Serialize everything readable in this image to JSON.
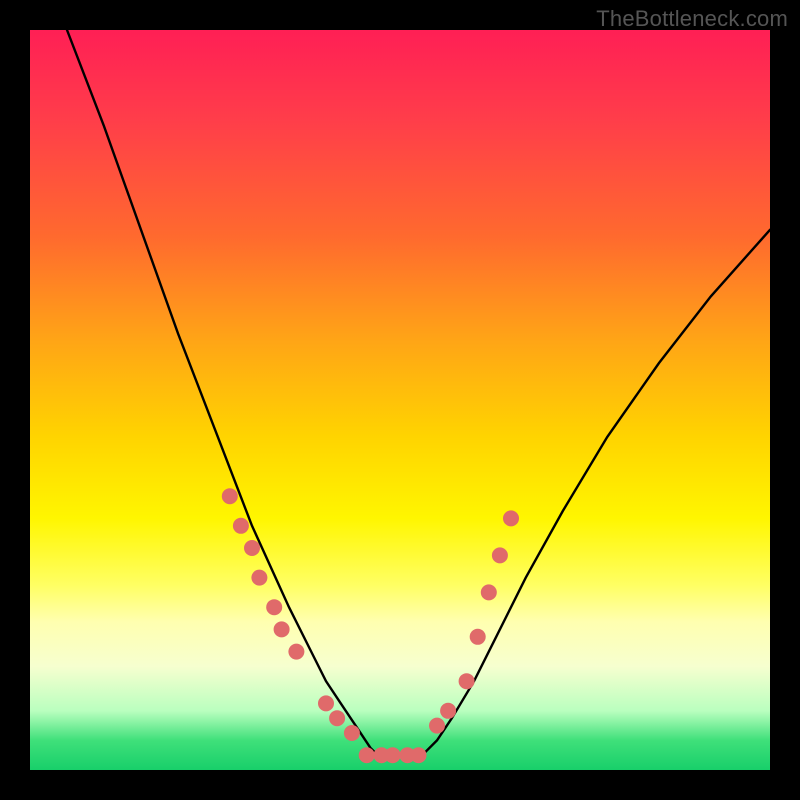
{
  "watermark": "TheBottleneck.com",
  "chart_data": {
    "type": "line",
    "title": "",
    "xlabel": "",
    "ylabel": "",
    "xlim": [
      0,
      100
    ],
    "ylim": [
      0,
      100
    ],
    "series": [
      {
        "name": "left-curve",
        "x": [
          5,
          10,
          15,
          20,
          25,
          30,
          35,
          38,
          40,
          42,
          44,
          46,
          47
        ],
        "y": [
          100,
          87,
          73,
          59,
          46,
          33,
          22,
          16,
          12,
          9,
          6,
          3,
          2
        ]
      },
      {
        "name": "right-curve",
        "x": [
          53,
          55,
          57,
          60,
          63,
          67,
          72,
          78,
          85,
          92,
          100
        ],
        "y": [
          2,
          4,
          7,
          12,
          18,
          26,
          35,
          45,
          55,
          64,
          73
        ]
      }
    ],
    "floor": {
      "name": "valley-floor",
      "x": [
        47,
        53
      ],
      "y": [
        2,
        2
      ]
    },
    "markers_left": {
      "name": "left-dots",
      "x": [
        27,
        28.5,
        30,
        31,
        33,
        34,
        36,
        40,
        41.5,
        43.5
      ],
      "y": [
        37,
        33,
        30,
        26,
        22,
        19,
        16,
        9,
        7,
        5
      ]
    },
    "markers_right": {
      "name": "right-dots",
      "x": [
        55,
        56.5,
        59,
        60.5,
        62,
        63.5,
        65
      ],
      "y": [
        6,
        8,
        12,
        18,
        24,
        29,
        34
      ]
    },
    "markers_floor": {
      "name": "floor-dots",
      "x": [
        45.5,
        47.5,
        49,
        51,
        52.5
      ],
      "y": [
        2,
        2,
        2,
        2,
        2
      ]
    },
    "marker_color": "#e06a6a",
    "marker_radius_px": 8,
    "line_color": "#000000"
  }
}
